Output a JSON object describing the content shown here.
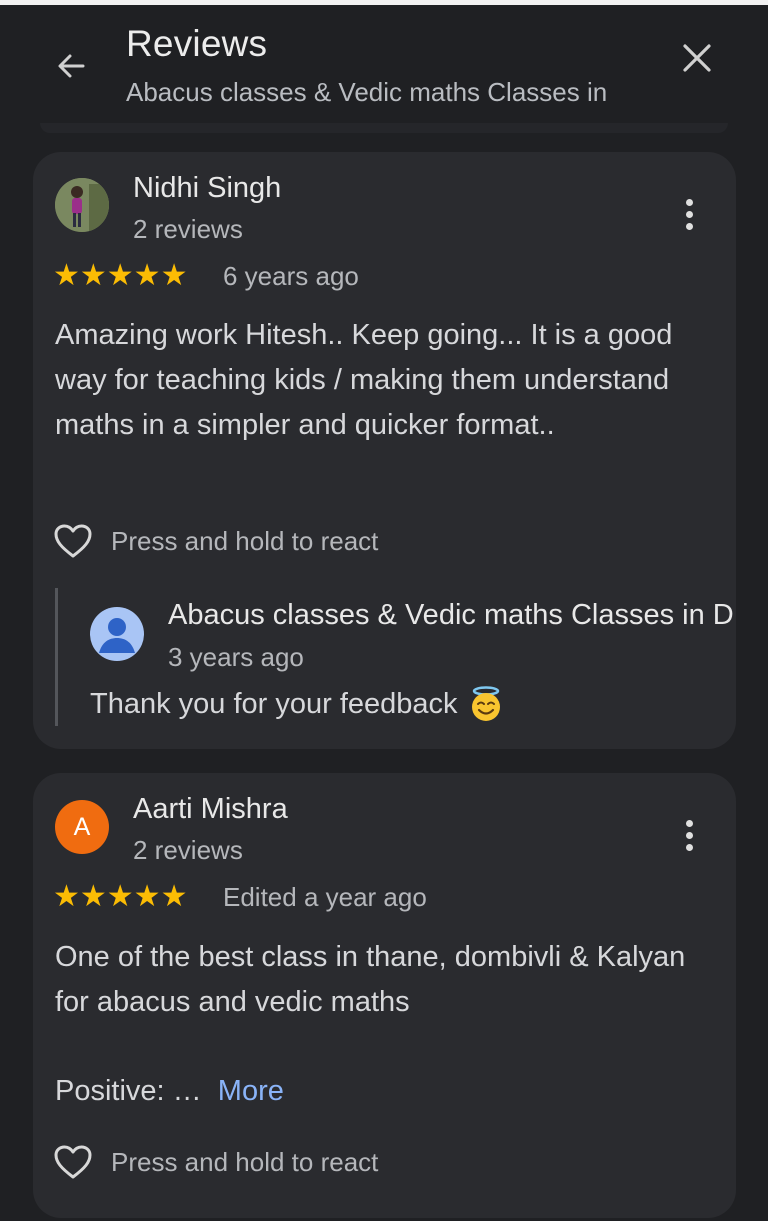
{
  "header": {
    "title": "Reviews",
    "subtitle": "Abacus classes & Vedic maths Classes in"
  },
  "reviews": [
    {
      "name": "Nidhi Singh",
      "review_count": "2 reviews",
      "rating": 5,
      "stars": "★★★★★",
      "time": "6 years ago",
      "text": "Amazing work Hitesh.. Keep going... It is a good way for teaching kids / making them understand maths in a simpler and quicker format..",
      "react_label": "Press and hold to react",
      "owner_reply": {
        "name": "Abacus classes & Vedic maths Classes in D",
        "time": "3 years ago",
        "text": "Thank you for your feedback",
        "emoji": "smiling-face-with-halo"
      }
    },
    {
      "name": "Aarti Mishra",
      "avatar_letter": "A",
      "review_count": "2 reviews",
      "rating": 5,
      "stars": "★★★★★",
      "time": "Edited a year ago",
      "text": "One of the best class in thane, dombivli & Kalyan for abacus and vedic maths",
      "text_more_prefix": "Positive: …",
      "more_label": "More",
      "react_label": "Press and hold to react"
    }
  ],
  "colors": {
    "background": "#1f2023",
    "card": "#2a2b2f",
    "star": "#fbbc04",
    "link": "#8ab4f8",
    "avatar_orange": "#f06c10",
    "owner_avatar": "#a9c5f5"
  },
  "icons": [
    "arrow-back-icon",
    "close-icon",
    "more-vert-icon",
    "star-icon",
    "heart-outline-icon",
    "person-icon",
    "halo-emoji-icon"
  ]
}
